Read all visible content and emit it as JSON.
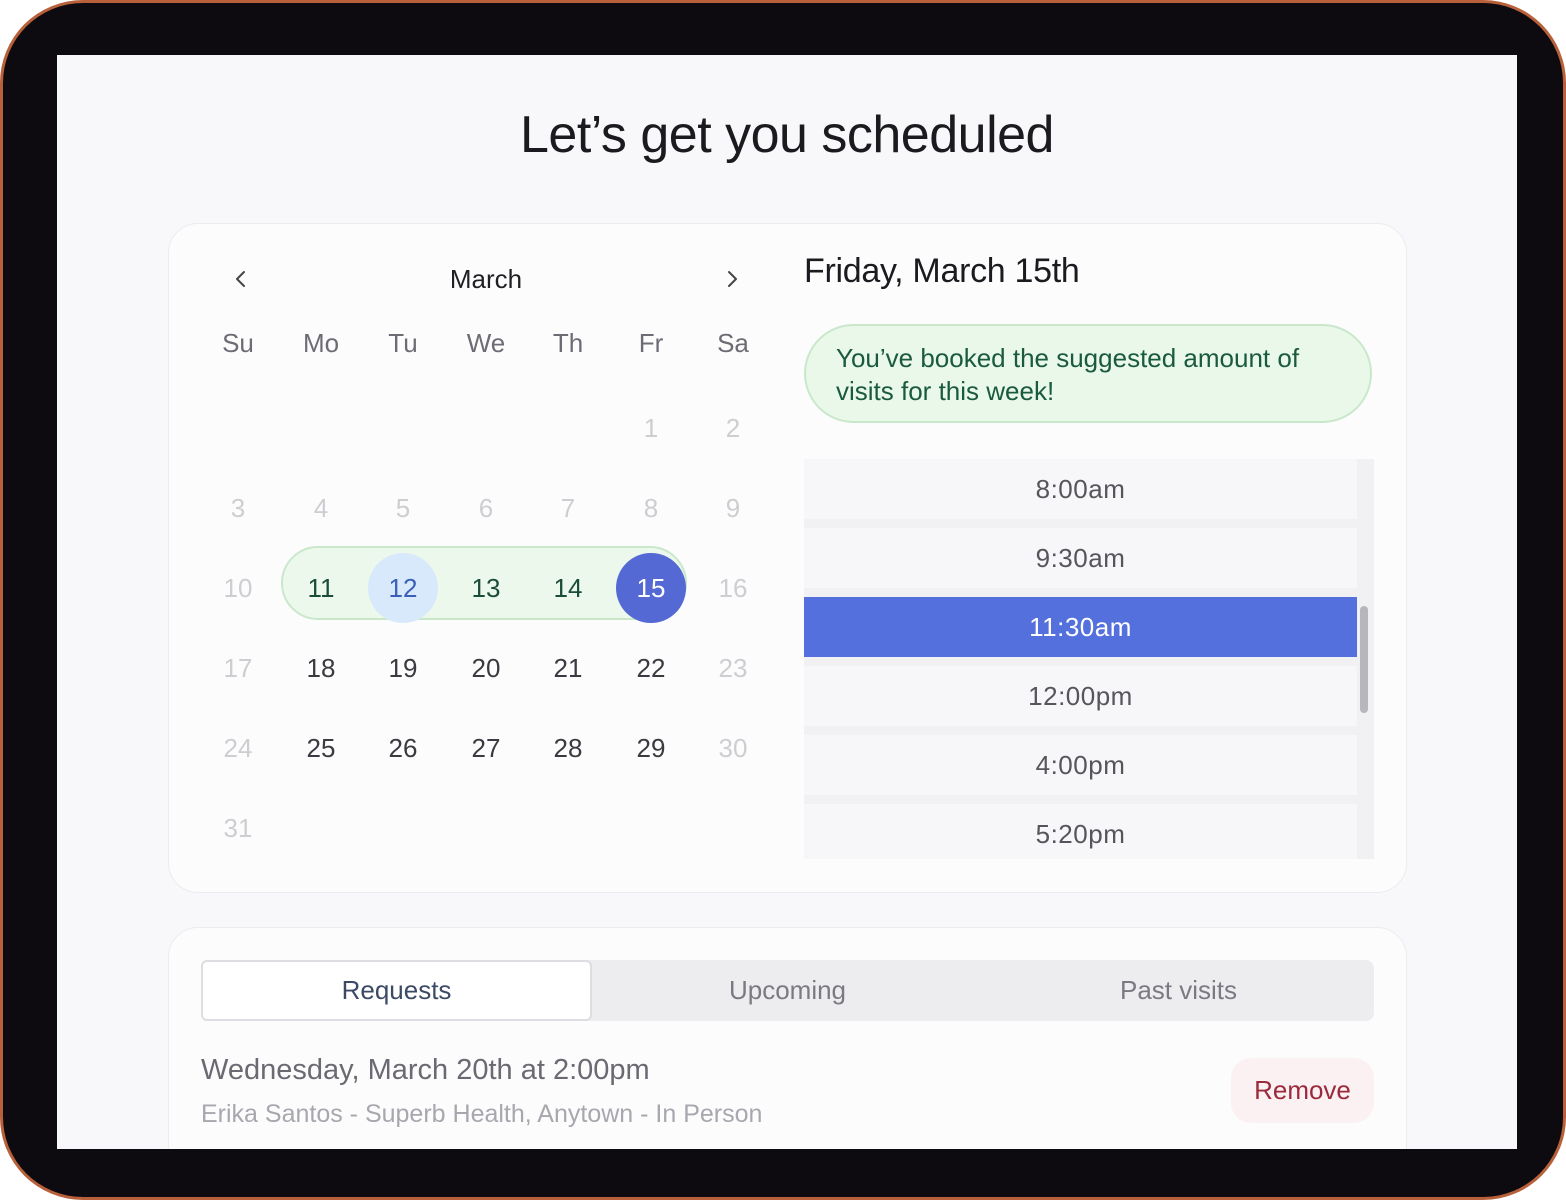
{
  "page": {
    "title": "Let’s get you scheduled"
  },
  "calendar": {
    "month": "March",
    "weekdays": [
      "Su",
      "Mo",
      "Tu",
      "We",
      "Th",
      "Fr",
      "Sa"
    ],
    "days": [
      {
        "label": "1",
        "state": "dim"
      },
      {
        "label": "2",
        "state": "dim"
      },
      {
        "label": "3",
        "state": "dim"
      },
      {
        "label": "4",
        "state": "dim"
      },
      {
        "label": "5",
        "state": "dim"
      },
      {
        "label": "6",
        "state": "dim"
      },
      {
        "label": "7",
        "state": "dim"
      },
      {
        "label": "8",
        "state": "dim"
      },
      {
        "label": "9",
        "state": "dim"
      },
      {
        "label": "10",
        "state": "dim"
      },
      {
        "label": "11",
        "state": "week"
      },
      {
        "label": "12",
        "state": "today"
      },
      {
        "label": "13",
        "state": "week"
      },
      {
        "label": "14",
        "state": "week"
      },
      {
        "label": "15",
        "state": "selected"
      },
      {
        "label": "16",
        "state": "dim"
      },
      {
        "label": "17",
        "state": "dim"
      },
      {
        "label": "18",
        "state": "normal"
      },
      {
        "label": "19",
        "state": "normal"
      },
      {
        "label": "20",
        "state": "normal"
      },
      {
        "label": "21",
        "state": "normal"
      },
      {
        "label": "22",
        "state": "normal"
      },
      {
        "label": "23",
        "state": "dim"
      },
      {
        "label": "24",
        "state": "dim"
      },
      {
        "label": "25",
        "state": "normal"
      },
      {
        "label": "26",
        "state": "normal"
      },
      {
        "label": "27",
        "state": "normal"
      },
      {
        "label": "28",
        "state": "normal"
      },
      {
        "label": "29",
        "state": "normal"
      },
      {
        "label": "30",
        "state": "dim"
      },
      {
        "label": "31",
        "state": "dim"
      }
    ],
    "icons": {
      "prev": "chevron-left-icon",
      "next": "chevron-right-icon"
    }
  },
  "schedule": {
    "selected_date": "Friday, March 15th",
    "banner": "You’ve booked the suggested amount of visits for this week!",
    "slots": [
      "8:00am",
      "9:30am",
      "11:30am",
      "12:00pm",
      "4:00pm",
      "5:20pm"
    ],
    "selected_slot": "11:30am"
  },
  "visits": {
    "tabs": [
      {
        "label": "Requests",
        "active": true
      },
      {
        "label": "Upcoming",
        "active": false
      },
      {
        "label": "Past visits",
        "active": false
      }
    ],
    "requests": [
      {
        "title": "Wednesday, March 20th at 2:00pm",
        "detail": "Erika Santos - Superb Health, Anytown - In Person",
        "action": "Remove"
      }
    ]
  },
  "colors": {
    "accent": "#5469d4",
    "success_bg": "#eaf8ea",
    "success_text": "#1a5a3d",
    "danger_text": "#9b2a3c",
    "frame": "#b8603a"
  }
}
